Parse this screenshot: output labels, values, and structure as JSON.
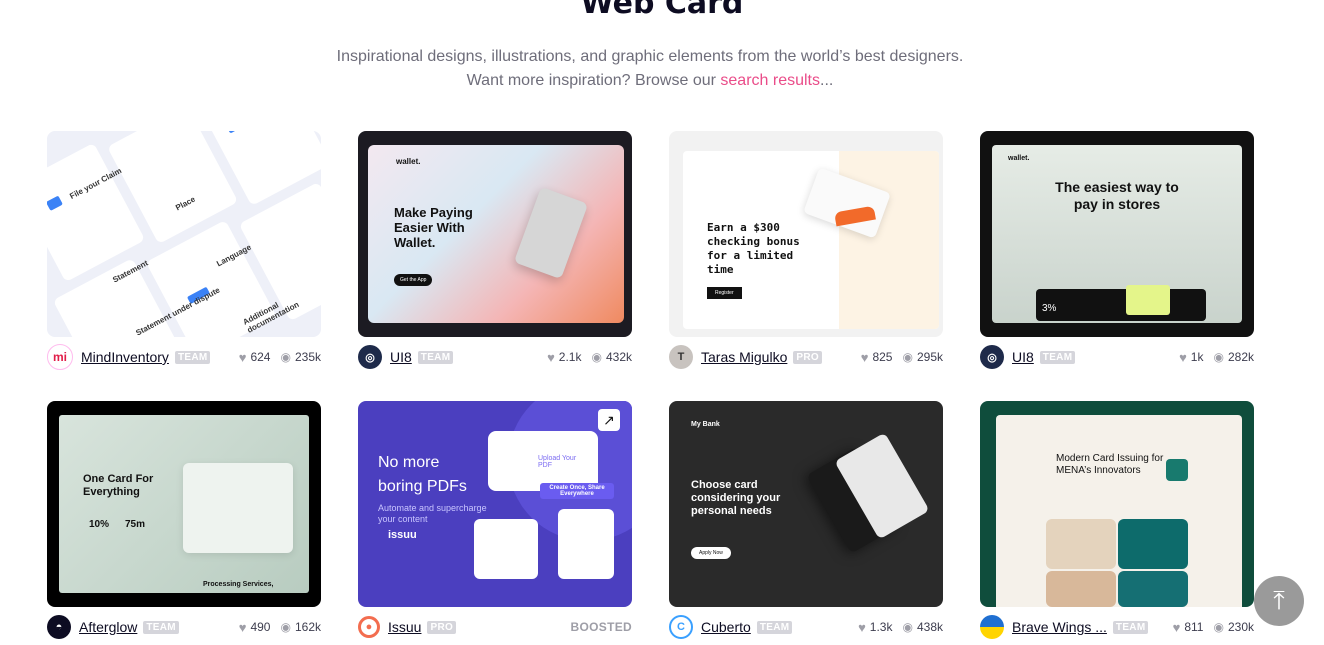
{
  "page": {
    "title": "Web Card",
    "subtitle_line1": "Inspirational designs, illustrations, and graphic elements from the world’s best designers.",
    "subtitle_line2_prefix": "Want more inspiration? Browse our",
    "subtitle_link": "search results",
    "subtitle_suffix": "..."
  },
  "colors": {
    "accent": "#ea4c89",
    "muted": "#9e9ea7",
    "badge": "#d5d5db"
  },
  "shots": [
    {
      "author": "MindInventory",
      "badge": "TEAM",
      "likes": "624",
      "views": "235k",
      "texts": [
        "File your Claim",
        "Place",
        "Language",
        "Statement",
        "Additional documentation",
        "Statement under dispute"
      ]
    },
    {
      "author": "UI8",
      "badge": "TEAM",
      "likes": "2.1k",
      "views": "432k",
      "texts": [
        "wallet.",
        "Make Paying Easier With Wallet.",
        "Get the App"
      ]
    },
    {
      "author": "Taras Migulko",
      "badge": "PRO",
      "likes": "825",
      "views": "295k",
      "texts": [
        "Earn a $300 checking bonus for a limited time",
        "Register"
      ]
    },
    {
      "author": "UI8",
      "badge": "TEAM",
      "likes": "1k",
      "views": "282k",
      "texts": [
        "wallet.",
        "The easiest way to pay in stores",
        "3%"
      ]
    },
    {
      "author": "Afterglow",
      "badge": "TEAM",
      "likes": "490",
      "views": "162k",
      "texts": [
        "One Card For Everything",
        "10%",
        "75m",
        "Processing Services,"
      ]
    },
    {
      "author": "Issuu",
      "badge": "PRO",
      "boosted": "BOOSTED",
      "texts": [
        "No more boring PDFs",
        "Automate and supercharge your content",
        "issuu",
        "Upload Your PDF",
        "Create Once, Share Everywhere"
      ]
    },
    {
      "author": "Cuberto",
      "badge": "TEAM",
      "likes": "1.3k",
      "views": "438k",
      "texts": [
        "My Bank",
        "Choose card considering your personal needs",
        "Apply Now"
      ]
    },
    {
      "author": "Brave Wings ...",
      "badge": "TEAM",
      "likes": "811",
      "views": "230k",
      "texts": [
        "Modern Card Issuing for MENA’s Innovators"
      ]
    }
  ],
  "icons": {
    "heart": "heart-icon",
    "views": "eye-icon",
    "scroll_top": "arrow-up-icon"
  }
}
